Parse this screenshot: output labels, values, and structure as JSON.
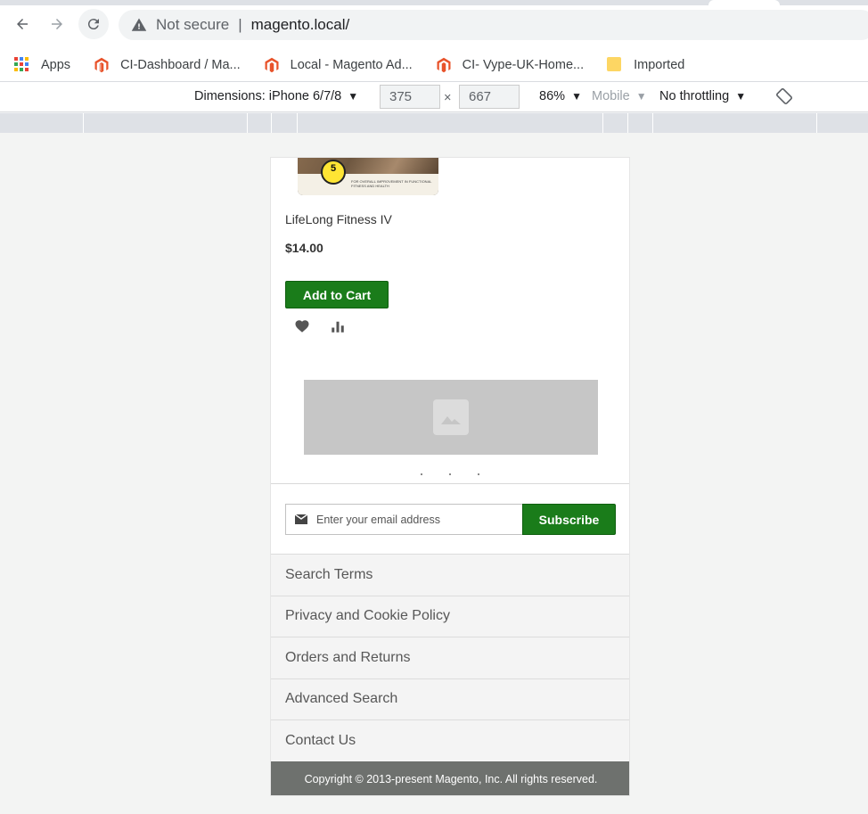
{
  "browser": {
    "security_label": "Not secure",
    "separator": "|",
    "url": "magento.local/",
    "bookmarks": [
      {
        "label": "Apps"
      },
      {
        "label": "CI-Dashboard / Ma..."
      },
      {
        "label": "Local - Magento Ad..."
      },
      {
        "label": "CI- Vype-UK-Home..."
      },
      {
        "label": "Imported"
      }
    ]
  },
  "devtools": {
    "dimensions_label": "Dimensions: iPhone 6/7/8",
    "width": "375",
    "times": "×",
    "height": "667",
    "zoom": "86%",
    "device_type": "Mobile",
    "throttling": "No throttling",
    "dropdown_arrow": "▼"
  },
  "product": {
    "badge_number": "5",
    "image_caption": "FOR OVERALL IMPROVEMENT IN FUNCTIONAL FITNESS AND HEALTH",
    "name": "LifeLong Fitness IV",
    "price": "$14.00",
    "add_to_cart_label": "Add to Cart"
  },
  "newsletter": {
    "email_placeholder": "Enter your email address",
    "subscribe_label": "Subscribe"
  },
  "footer": {
    "links": [
      {
        "label": "Search Terms"
      },
      {
        "label": "Privacy and Cookie Policy"
      },
      {
        "label": "Orders and Returns"
      },
      {
        "label": "Advanced Search"
      },
      {
        "label": "Contact Us"
      }
    ],
    "copyright": "Copyright © 2013-present Magento, Inc. All rights reserved."
  },
  "colors": {
    "button_green": "#1a7c1a",
    "footer_gray": "#6e716e",
    "magento_orange": "#e8532b"
  }
}
